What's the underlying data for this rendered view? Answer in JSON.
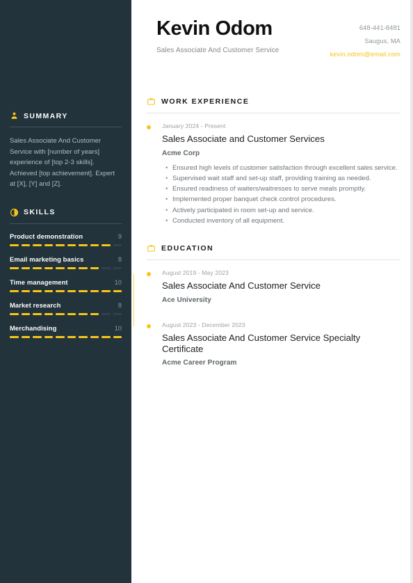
{
  "header": {
    "name": "Kevin Odom",
    "job_title": "Sales Associate And Customer Service",
    "phone": "648-441-8481",
    "location": "Saugus, MA",
    "email": "kevin.odom@email.com",
    "email_color": "#f5c518"
  },
  "sidebar": {
    "summary": {
      "icon": "person-icon",
      "heading": "SUMMARY",
      "text": "Sales Associate And Customer Service with [number of years] experience of [top 2-3 skills]. Achieved [top achievement]. Expert at [X], [Y] and [Z]."
    },
    "skills": {
      "icon": "pie-chart-icon",
      "heading": "SKILLS",
      "max": 10,
      "items": [
        {
          "name": "Product demonstration",
          "score": 9
        },
        {
          "name": "Email marketing basics",
          "score": 8
        },
        {
          "name": "Time management",
          "score": 10
        },
        {
          "name": "Market research",
          "score": 8
        },
        {
          "name": "Merchandising",
          "score": 10
        }
      ]
    }
  },
  "main": {
    "work": {
      "icon": "briefcase-icon",
      "heading": "WORK EXPERIENCE",
      "entries": [
        {
          "date": "January 2024 - Present",
          "title": "Sales Associate and Customer Services",
          "org": "Acme Corp",
          "bullets": [
            "Ensured high levels of customer satisfaction through excellent sales service.",
            "Supervised wait staff and set-up staff, providing training as needed.",
            "Ensured readiness of waiters/waitresses to serve meals promptly.",
            "Implemented proper banquet check control procedures.",
            "Actively participated in room set-up and service.",
            "Conducted inventory of all equipment."
          ]
        }
      ]
    },
    "education": {
      "icon": "briefcase-icon",
      "heading": "EDUCATION",
      "entries": [
        {
          "date": "August 2019 - May 2023",
          "title": "Sales Associate And Customer Service",
          "org": "Ace University"
        },
        {
          "date": "August 2023 - December 2023",
          "title": "Sales Associate And Customer Service Specialty Certificate",
          "org": "Acme Career Program"
        }
      ]
    }
  },
  "theme": {
    "sidebar_bg": "#22333b",
    "accent": "#f5c518",
    "page_bg": "#ffffff"
  }
}
